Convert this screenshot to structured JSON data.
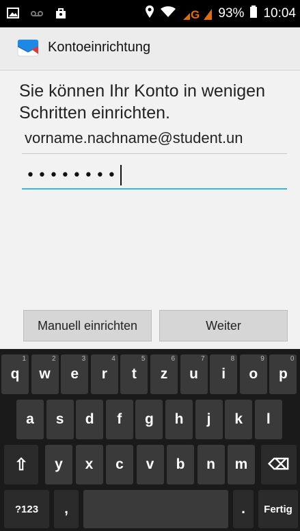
{
  "status_bar": {
    "battery_percent": "93%",
    "time": "10:04",
    "network": "G"
  },
  "action_bar": {
    "title": "Kontoeinrichtung"
  },
  "form": {
    "headline": "Sie können Ihr Konto in wenigen Schritten einrichten.",
    "email_value": "vorname.nachname@student.un",
    "password_mask": "••••••••"
  },
  "buttons": {
    "manual_label": "Manuell einrichten",
    "next_label": "Weiter"
  },
  "keyboard": {
    "row1": [
      {
        "label": "q",
        "hint": "1"
      },
      {
        "label": "w",
        "hint": "2"
      },
      {
        "label": "e",
        "hint": "3"
      },
      {
        "label": "r",
        "hint": "4"
      },
      {
        "label": "t",
        "hint": "5"
      },
      {
        "label": "z",
        "hint": "6"
      },
      {
        "label": "u",
        "hint": "7"
      },
      {
        "label": "i",
        "hint": "8"
      },
      {
        "label": "o",
        "hint": "9"
      },
      {
        "label": "p",
        "hint": "0"
      }
    ],
    "row2": [
      "a",
      "s",
      "d",
      "f",
      "g",
      "h",
      "j",
      "k",
      "l"
    ],
    "row3": [
      "y",
      "x",
      "c",
      "v",
      "b",
      "n",
      "m"
    ],
    "shift_symbol": "⇧",
    "backspace_symbol": "⌫",
    "symbols_label": "?123",
    "comma_label": ",",
    "period_label": ".",
    "done_label": "Fertig"
  }
}
